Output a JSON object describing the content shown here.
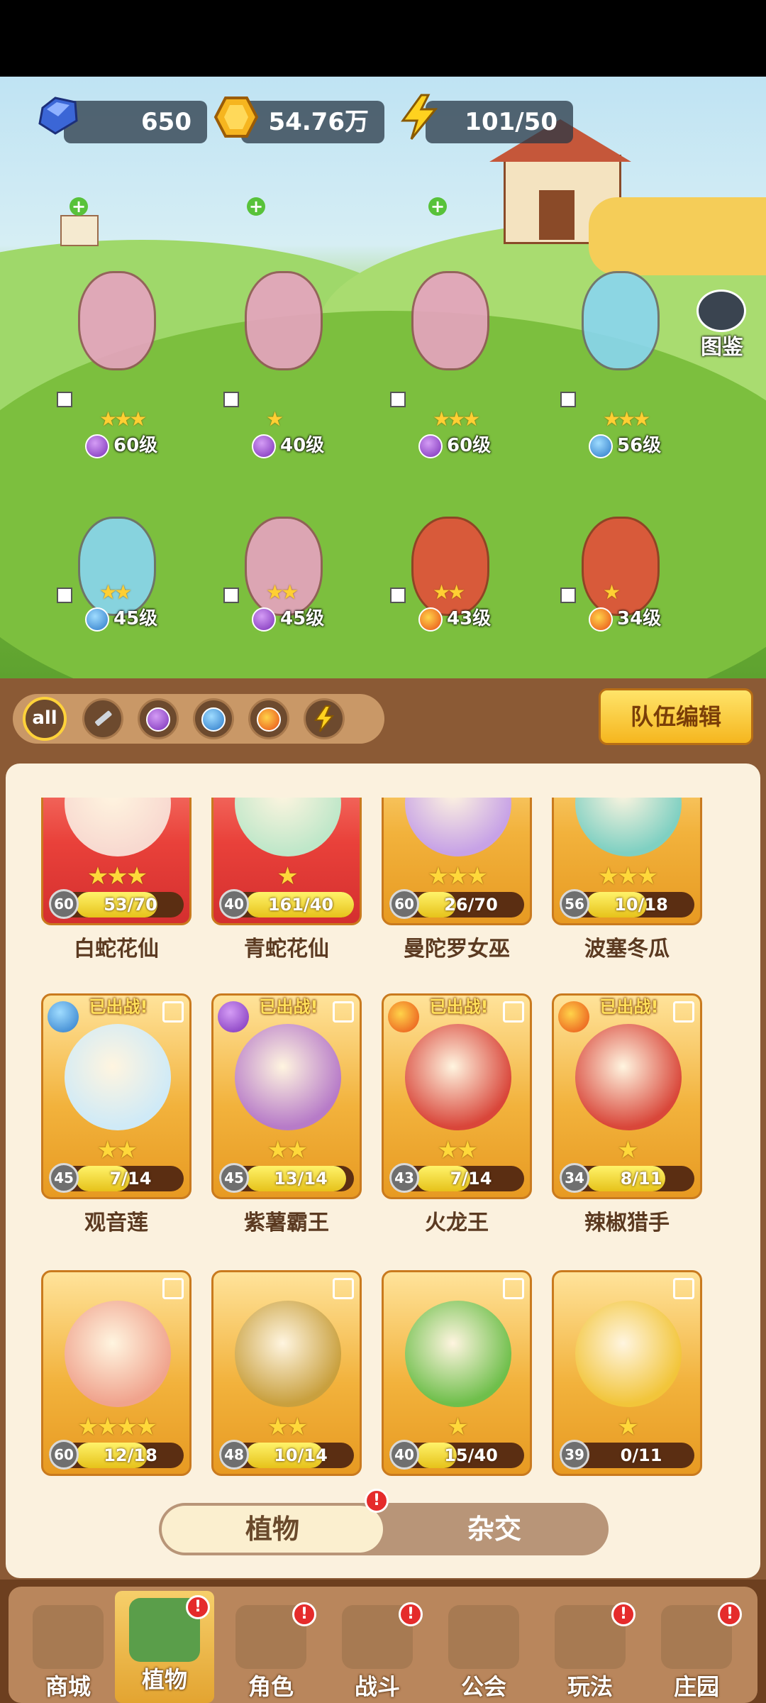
{
  "resources": {
    "gems": "650",
    "gold": "54.76万",
    "energy": "101/50"
  },
  "scene": {
    "codex_label": "图鉴",
    "team": [
      {
        "level": "60级",
        "stars": "★★★",
        "element": "purple"
      },
      {
        "level": "40级",
        "stars": "★",
        "element": "purple"
      },
      {
        "level": "60级",
        "stars": "★★★",
        "element": "purple"
      },
      {
        "level": "56级",
        "stars": "★★★",
        "element": "water"
      },
      {
        "level": "45级",
        "stars": "★★",
        "element": "water"
      },
      {
        "level": "45级",
        "stars": "★★",
        "element": "purple"
      },
      {
        "level": "43级",
        "stars": "★★",
        "element": "fire"
      },
      {
        "level": "34级",
        "stars": "★",
        "element": "fire"
      }
    ]
  },
  "filters": {
    "items": [
      "all",
      "sword",
      "potion",
      "water",
      "fire",
      "lightning"
    ],
    "all_label": "all",
    "team_edit": "队伍编辑"
  },
  "cards": [
    {
      "name": "白蛇花仙",
      "level": "60",
      "progress": "53/70",
      "fill": 0.757,
      "stars": "★★★",
      "deployed": "",
      "style": "red"
    },
    {
      "name": "青蛇花仙",
      "level": "40",
      "progress": "161/40",
      "fill": 1.0,
      "stars": "★",
      "deployed": "",
      "style": "red"
    },
    {
      "name": "曼陀罗女巫",
      "level": "60",
      "progress": "26/70",
      "fill": 0.371,
      "stars": "★★★",
      "deployed": "",
      "style": "gold"
    },
    {
      "name": "波塞冬瓜",
      "level": "56",
      "progress": "10/18",
      "fill": 0.556,
      "stars": "★★★",
      "deployed": "",
      "style": "gold"
    },
    {
      "name": "观音莲",
      "level": "45",
      "progress": "7/14",
      "fill": 0.5,
      "stars": "★★",
      "deployed": "已出战!",
      "style": "gold"
    },
    {
      "name": "紫薯霸王",
      "level": "45",
      "progress": "13/14",
      "fill": 0.929,
      "stars": "★★",
      "deployed": "已出战!",
      "style": "gold"
    },
    {
      "name": "火龙王",
      "level": "43",
      "progress": "7/14",
      "fill": 0.5,
      "stars": "★★",
      "deployed": "已出战!",
      "style": "gold"
    },
    {
      "name": "辣椒猎手",
      "level": "34",
      "progress": "8/11",
      "fill": 0.727,
      "stars": "★",
      "deployed": "已出战!",
      "style": "gold"
    },
    {
      "name": "",
      "level": "60",
      "progress": "12/18",
      "fill": 0.667,
      "stars": "★★★★",
      "deployed": "",
      "style": "gold"
    },
    {
      "name": "",
      "level": "48",
      "progress": "10/14",
      "fill": 0.714,
      "stars": "★★",
      "deployed": "",
      "style": "gold"
    },
    {
      "name": "",
      "level": "40",
      "progress": "15/40",
      "fill": 0.375,
      "stars": "★",
      "deployed": "",
      "style": "gold"
    },
    {
      "name": "",
      "level": "39",
      "progress": "0/11",
      "fill": 0.0,
      "stars": "★",
      "deployed": "",
      "style": "gold"
    }
  ],
  "toggle": {
    "plants": "植物",
    "hybrid": "杂交",
    "badge": "!"
  },
  "nav": [
    {
      "label": "商城",
      "badge": ""
    },
    {
      "label": "植物",
      "badge": "!"
    },
    {
      "label": "角色",
      "badge": "!"
    },
    {
      "label": "战斗",
      "badge": "!"
    },
    {
      "label": "公会",
      "badge": ""
    },
    {
      "label": "玩法",
      "badge": "!"
    },
    {
      "label": "庄园",
      "badge": "!"
    }
  ],
  "colors": {
    "panel_brown": "#8b5a35",
    "card_gold": "#f2b23c",
    "card_red": "#e9413a",
    "progress_yellow": "#e6c21a",
    "badge_red": "#e52b2b"
  }
}
